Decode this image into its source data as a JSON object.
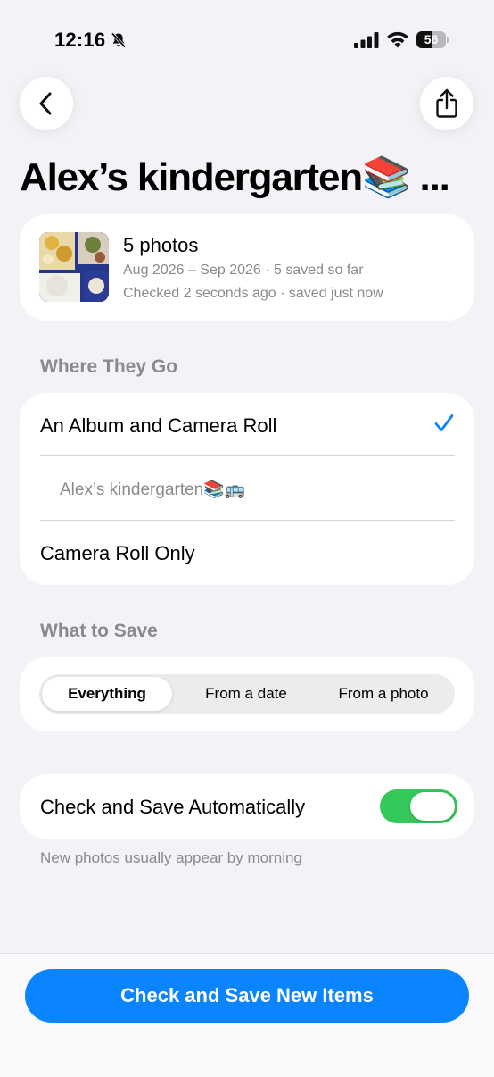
{
  "status_bar": {
    "time": "12:16",
    "battery_level": "56",
    "silent_icon": "bell-slash-icon"
  },
  "nav": {
    "back_icon": "chevron-left-icon",
    "share_icon": "share-icon"
  },
  "title": "Alex’s kindergarten📚 ...",
  "summary": {
    "title": "5 photos",
    "line1": "Aug 2026 – Sep 2026 · 5 saved so far",
    "line2": "Checked 2 seconds ago · saved just now"
  },
  "where_they_go": {
    "header": "Where They Go",
    "options": [
      {
        "label": "An Album and Camera Roll",
        "selected": true
      },
      {
        "label": "Alex’s kindergarten📚🚌",
        "is_album_name": true
      },
      {
        "label": "Camera Roll Only",
        "selected": false
      }
    ]
  },
  "what_to_save": {
    "header": "What to Save",
    "segments": [
      "Everything",
      "From a date",
      "From a photo"
    ],
    "selected": "Everything"
  },
  "auto_save": {
    "label": "Check and Save Automatically",
    "enabled": true,
    "footnote": "New photos usually appear by morning"
  },
  "primary_action": "Check and Save New Items",
  "colors": {
    "accent": "#0a84ff",
    "toggle_on": "#34c759",
    "background": "#f2f2f7",
    "secondary_text": "#8a8a8e"
  }
}
